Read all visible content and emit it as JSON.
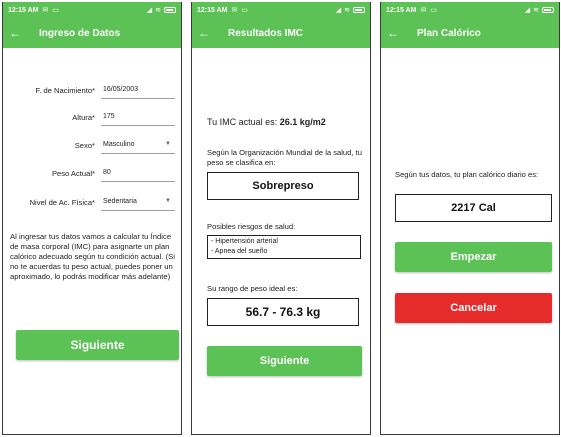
{
  "status": {
    "time": "12:15 AM",
    "icons": "✉ ▭"
  },
  "screen1": {
    "title": "Ingreso de Datos",
    "fields": [
      {
        "label": "F. de Nacimiento*",
        "value": "16/05/2003"
      },
      {
        "label": "Altura*",
        "value": "175"
      },
      {
        "label": "Sexo*",
        "value": "Masculino"
      },
      {
        "label": "Peso Actual*",
        "value": "80"
      },
      {
        "label": "Nivel de Ac. Física*",
        "value": "Sedentaria"
      }
    ],
    "info": "Al ingresar tus datos vamos a calcular tu Índice de masa corporal (IMC) para asignarte un plan calórico adecuado según tu condición actual. (Si no te acuerdas tu peso actual, puedes poner un aproximado, lo podrás modificar más adelante)",
    "next_label": "Siguiente"
  },
  "screen2": {
    "title": "Resultados IMC",
    "imc_prefix": "Tu IMC actual es: ",
    "imc_value": "26.1 kg/m2",
    "oms_text": "Según la Organización Mundial de la salud, tu peso se clasifica en:",
    "classification": "Sobrepreso",
    "risks_label": "Posibles riesgos de salud:",
    "risks": [
      "- Hipertensión arterial",
      "- Apnea del sueño"
    ],
    "ideal_label": "Su rango de peso ideal es:",
    "ideal_range": "56.7 - 76.3 kg",
    "next_label": "Siguiente"
  },
  "screen3": {
    "title": "Plan Calórico",
    "plan_text": "Según tus datos, tu plan calórico diario es:",
    "calories": "2217 Cal",
    "start_label": "Empezar",
    "cancel_label": "Cancelar"
  },
  "colors": {
    "primary": "#5dc256",
    "danger": "#e62b2b"
  },
  "icons": {
    "back": "arrow-left-icon",
    "wifi": "wifi-icon",
    "signal": "signal-icon",
    "battery": "battery-icon"
  }
}
